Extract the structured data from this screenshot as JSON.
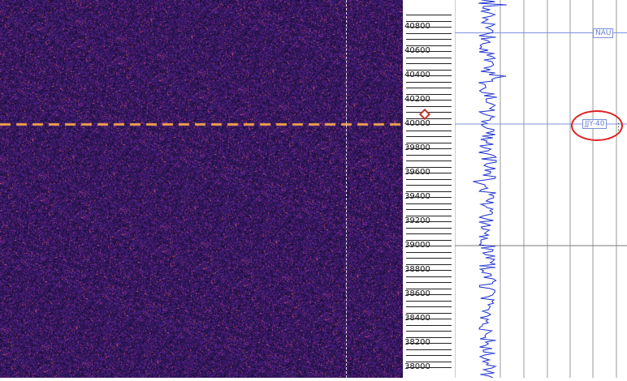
{
  "frequency_scale": {
    "labels": [
      "40800",
      "40600",
      "40400",
      "40200",
      "40000",
      "39800",
      "39600",
      "39400",
      "39200",
      "39000",
      "38800",
      "38600",
      "38400",
      "38200",
      "38000"
    ]
  },
  "stations": [
    {
      "name": "NAU",
      "freq_khz": 40750
    },
    {
      "name": "JJY-40",
      "freq_khz": 40000
    }
  ],
  "colors": {
    "waterfall_bg": "#3a1c66",
    "signal": "#f0a050",
    "spectrum_trace": "#1a2fd0",
    "station_line": "#8090e0",
    "annotation": "#e02020"
  },
  "icons": {
    "marker": "diamond-marker-icon",
    "menu": "more-vert-icon"
  }
}
